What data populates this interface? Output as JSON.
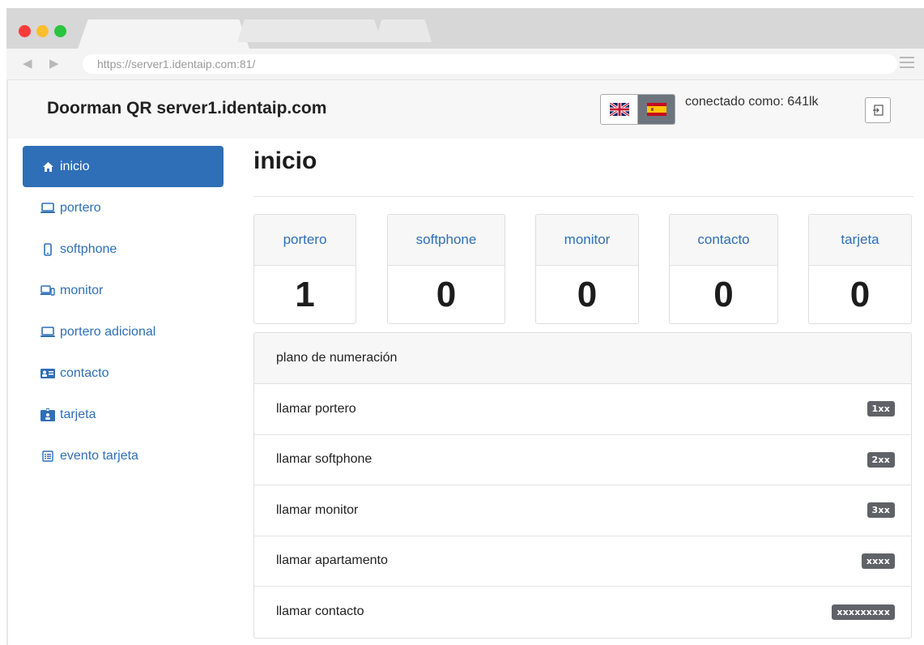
{
  "browser": {
    "url": "https://server1.identaip.com:81/"
  },
  "header": {
    "title": "Doorman QR server1.identaip.com",
    "connected_text": "conectado como: 641lk",
    "languages": [
      "en",
      "es"
    ],
    "active_language": "es"
  },
  "sidebar": {
    "items": [
      {
        "label": "inicio",
        "icon": "home-icon",
        "active": true
      },
      {
        "label": "portero",
        "icon": "laptop-icon"
      },
      {
        "label": "softphone",
        "icon": "phone-icon"
      },
      {
        "label": "monitor",
        "icon": "monitor-icon"
      },
      {
        "label": "portero adicional",
        "icon": "laptop-icon"
      },
      {
        "label": "contacto",
        "icon": "contact-card-icon"
      },
      {
        "label": "tarjeta",
        "icon": "badge-icon"
      },
      {
        "label": "evento tarjeta",
        "icon": "list-icon"
      }
    ]
  },
  "main": {
    "title": "inicio",
    "stats": [
      {
        "label": "portero",
        "value": "1"
      },
      {
        "label": "softphone",
        "value": "0"
      },
      {
        "label": "monitor",
        "value": "0"
      },
      {
        "label": "contacto",
        "value": "0"
      },
      {
        "label": "tarjeta",
        "value": "0"
      }
    ],
    "dialplan": {
      "title": "plano de numeración",
      "rows": [
        {
          "label": "llamar portero",
          "code": "1xx"
        },
        {
          "label": "llamar softphone",
          "code": "2xx"
        },
        {
          "label": "llamar monitor",
          "code": "3xx"
        },
        {
          "label": "llamar apartamento",
          "code": "xxxx"
        },
        {
          "label": "llamar contacto",
          "code": "xxxxxxxxx"
        }
      ]
    }
  },
  "colors": {
    "accent": "#2f6fb7",
    "badge": "#5f6368"
  }
}
